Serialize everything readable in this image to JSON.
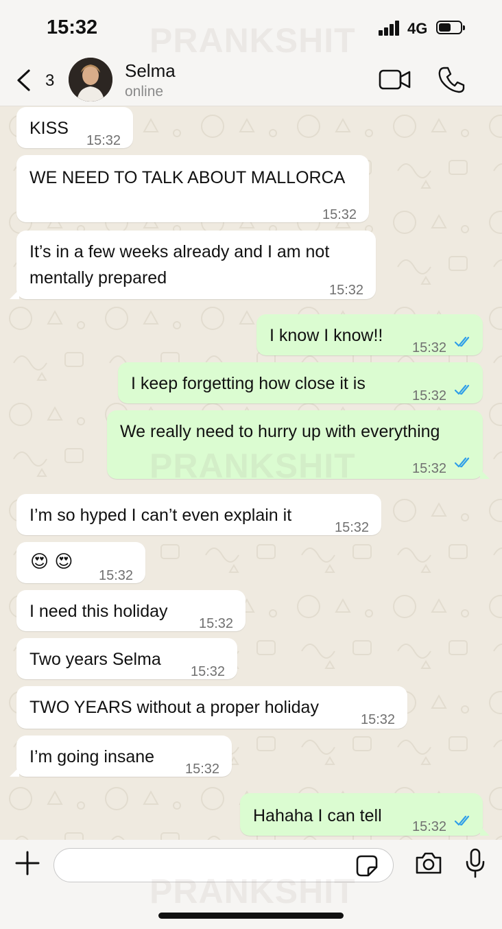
{
  "status_bar": {
    "time": "15:32",
    "network": "4G"
  },
  "header": {
    "back_count": "3",
    "contact_name": "Selma",
    "contact_status": "online"
  },
  "messages": [
    {
      "dir": "in",
      "text": "KISS",
      "time": "15:32"
    },
    {
      "dir": "in",
      "text": "WE NEED TO TALK ABOUT MALLORCA",
      "time": "15:32"
    },
    {
      "dir": "in",
      "text": "It’s in a few weeks already and I am not mentally prepared",
      "time": "15:32"
    },
    {
      "dir": "out",
      "text": "I know I know!!",
      "time": "15:32",
      "status": "read"
    },
    {
      "dir": "out",
      "text": "I keep forgetting how close it is",
      "time": "15:32",
      "status": "read"
    },
    {
      "dir": "out",
      "text": "We really need to hurry up with everything",
      "time": "15:32",
      "status": "read"
    },
    {
      "dir": "in",
      "text": "I’m so hyped I can’t even explain it",
      "time": "15:32"
    },
    {
      "dir": "in",
      "text": "😍 😍",
      "time": "15:32"
    },
    {
      "dir": "in",
      "text": "I need this holiday",
      "time": "15:32"
    },
    {
      "dir": "in",
      "text": "Two years Selma",
      "time": "15:32"
    },
    {
      "dir": "in",
      "text": "TWO YEARS without a proper holiday",
      "time": "15:32"
    },
    {
      "dir": "in",
      "text": "I’m going insane",
      "time": "15:32"
    },
    {
      "dir": "out",
      "text": "Hahaha I can tell",
      "time": "15:32",
      "status": "read"
    }
  ],
  "watermark": "PRANKSHIT",
  "input": {
    "placeholder": ""
  },
  "icons": {
    "back": "chevron-left-icon",
    "video_call": "video-camera-icon",
    "voice_call": "phone-icon",
    "attach": "plus-icon",
    "sticker": "sticker-icon",
    "camera": "camera-icon",
    "mic": "microphone-icon",
    "read_receipt": "double-check-icon"
  },
  "colors": {
    "incoming_bubble": "#ffffff",
    "outgoing_bubble": "#dbfcd1",
    "read_tick": "#2f9ee8",
    "chat_background": "#efeae0"
  }
}
